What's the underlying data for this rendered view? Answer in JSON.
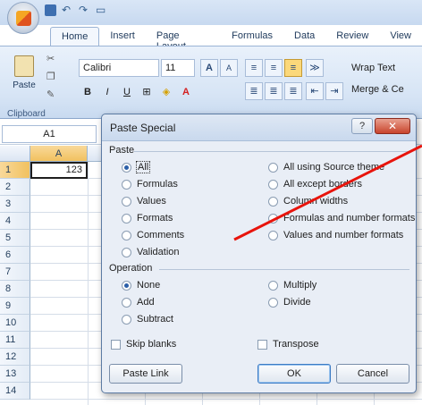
{
  "quick_access": {
    "icons": [
      "save-icon",
      "undo-icon",
      "redo-icon",
      "print-preview-icon"
    ]
  },
  "tabs": [
    "Home",
    "Insert",
    "Page Layout",
    "Formulas",
    "Data",
    "Review",
    "View"
  ],
  "ribbon": {
    "paste_label": "Paste",
    "clipboard_label": "Clipboard",
    "font_name": "Calibri",
    "font_size": "11",
    "bold": "B",
    "italic": "I",
    "underline": "U",
    "wrap_text": "Wrap Text",
    "merge": "Merge & Ce",
    "font_grow": "A",
    "font_shrink": "A"
  },
  "namebox": "A1",
  "columns": [
    "A"
  ],
  "rows": [
    "1",
    "2",
    "3",
    "4",
    "5",
    "6",
    "7",
    "8",
    "9",
    "10",
    "11",
    "12",
    "13",
    "14"
  ],
  "cell_a1": "123",
  "dialog": {
    "title": "Paste Special",
    "help": "?",
    "close": "✕",
    "paste_section": "Paste",
    "paste_options_left": [
      "All",
      "Formulas",
      "Values",
      "Formats",
      "Comments",
      "Validation"
    ],
    "paste_options_right": [
      "All using Source theme",
      "All except borders",
      "Column widths",
      "Formulas and number formats",
      "Values and number formats"
    ],
    "selected_paste": "All",
    "operation_section": "Operation",
    "operation_left": [
      "None",
      "Add",
      "Subtract"
    ],
    "operation_right": [
      "Multiply",
      "Divide"
    ],
    "selected_operation": "None",
    "skip_blanks": "Skip blanks",
    "transpose": "Transpose",
    "paste_link": "Paste Link",
    "ok": "OK",
    "cancel": "Cancel"
  },
  "colors": {
    "annotation": "#e8140c",
    "accent": "#2a5ea8"
  }
}
